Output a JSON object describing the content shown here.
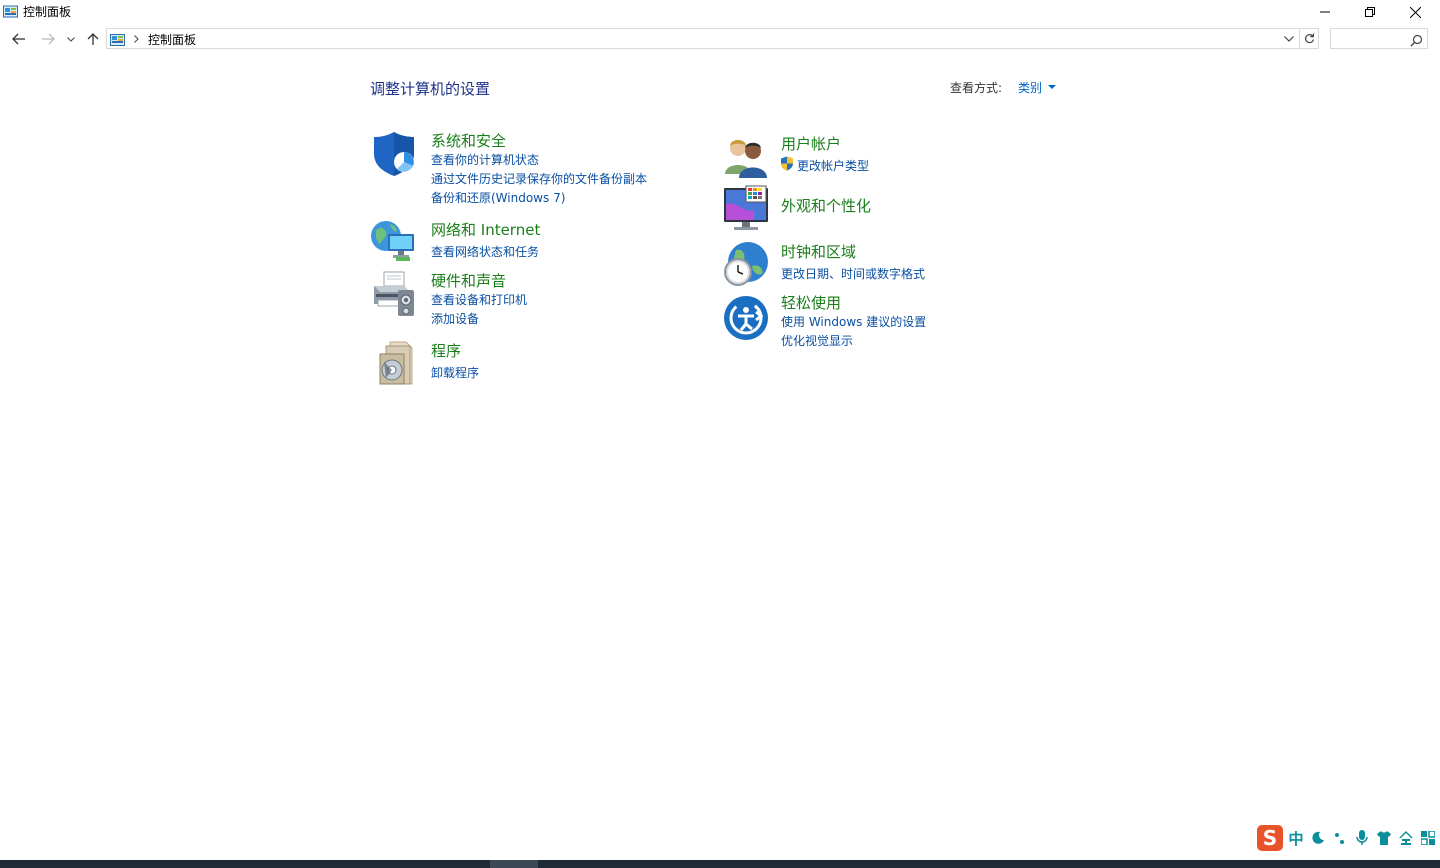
{
  "window": {
    "title": "控制面板",
    "controls": [
      "minimize",
      "restore",
      "close"
    ]
  },
  "addressbar": {
    "breadcrumb": "控制面板",
    "search_placeholder": ""
  },
  "main": {
    "title": "调整计算机的设置",
    "view_by_label": "查看方式:",
    "view_by_value": "类别",
    "categories": [
      {
        "title": "系统和安全",
        "icon": "shield-icon",
        "links": [
          "查看你的计算机状态",
          "通过文件历史记录保存你的文件备份副本",
          "备份和还原(Windows 7)"
        ]
      },
      {
        "title": "网络和 Internet",
        "icon": "network-icon",
        "links": [
          "查看网络状态和任务"
        ]
      },
      {
        "title": "硬件和声音",
        "icon": "printer-icon",
        "links": [
          "查看设备和打印机",
          "添加设备"
        ]
      },
      {
        "title": "程序",
        "icon": "programs-icon",
        "links": [
          "卸载程序"
        ]
      },
      {
        "title": "用户帐户",
        "icon": "users-icon",
        "links": [
          "更改帐户类型"
        ]
      },
      {
        "title": "外观和个性化",
        "icon": "monitor-icon",
        "links": []
      },
      {
        "title": "时钟和区域",
        "icon": "clock-globe-icon",
        "links": [
          "更改日期、时间或数字格式"
        ]
      },
      {
        "title": "轻松使用",
        "icon": "ease-of-access-icon",
        "links": [
          "使用 Windows 建议的设置",
          "优化视觉显示"
        ]
      }
    ]
  },
  "ime_toolbar": {
    "items": [
      "中"
    ],
    "brand_color": "#e8532b"
  },
  "colors": {
    "category_title": "#1a7f1a",
    "link": "#0a4fa3",
    "page_title": "#1e3287"
  }
}
